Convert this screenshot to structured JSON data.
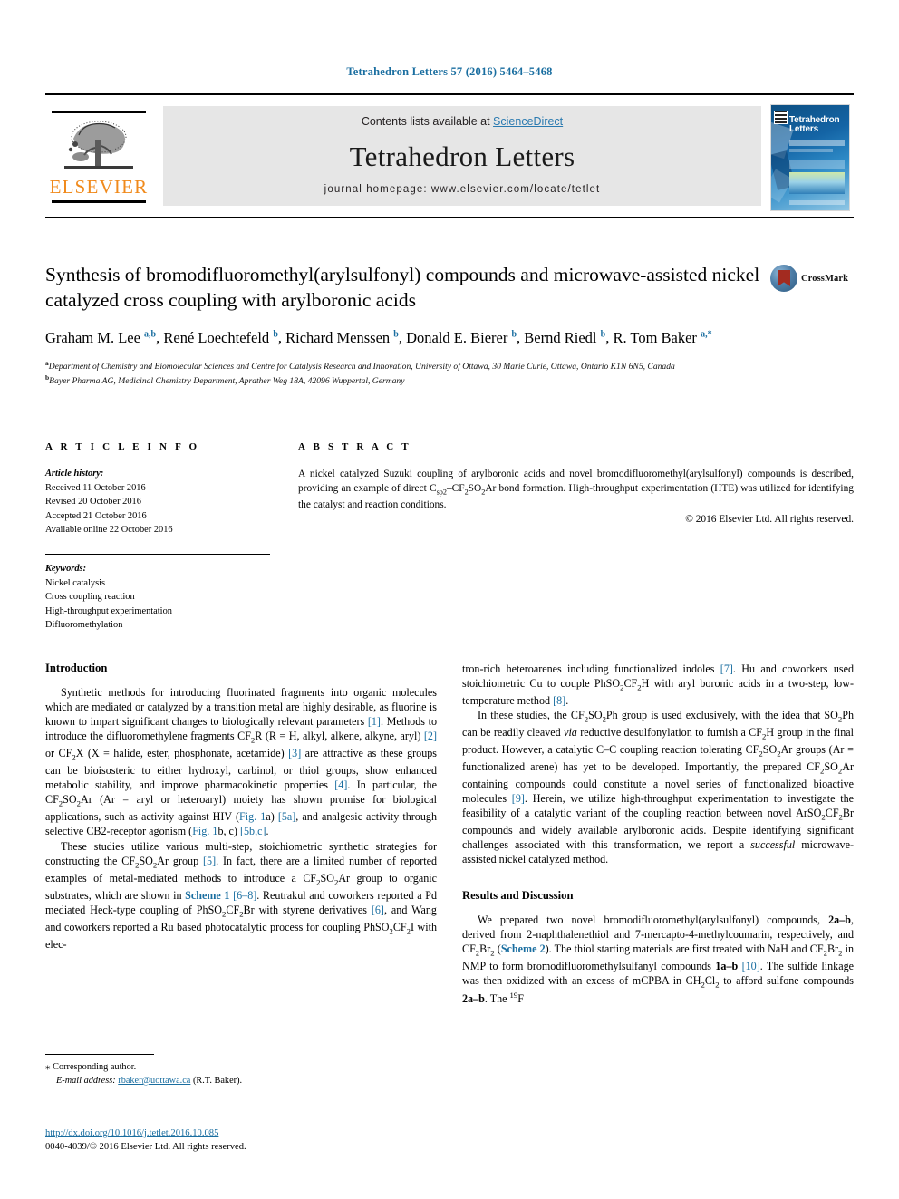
{
  "running_head": "Tetrahedron Letters 57 (2016) 5464–5468",
  "masthead": {
    "publisher_name": "ELSEVIER",
    "contents_prefix": "Contents lists available at ",
    "sciencedirect": "ScienceDirect",
    "journal_name": "Tetrahedron Letters",
    "homepage": "journal homepage: www.elsevier.com/locate/tetlet",
    "cover_title": "Tetrahedron Letters"
  },
  "article": {
    "title": "Synthesis of bromodifluoromethyl(arylsulfonyl) compounds and microwave-assisted nickel catalyzed cross coupling with arylboronic acids",
    "crossmark_label": "CrossMark",
    "authors_html": "Graham M. Lee <sup>a,b</sup>, René Loechtefeld <sup>b</sup>, Richard Menssen <sup>b</sup>, Donald E. Bierer <sup>b</sup>, Bernd Riedl <sup>b</sup>, R. Tom Baker <sup>a,*</sup>",
    "affiliations": [
      "Department of Chemistry and Biomolecular Sciences and Centre for Catalysis Research and Innovation, University of Ottawa, 30 Marie Curie, Ottawa, Ontario K1N 6N5, Canada",
      "Bayer Pharma AG, Medicinal Chemistry Department, Aprather Weg 18A, 42096 Wuppertal, Germany"
    ],
    "affiliation_marks": [
      "a",
      "b"
    ]
  },
  "article_info": {
    "heading": "A R T I C L E    I N F O",
    "history_label": "Article history:",
    "history": [
      "Received 11 October 2016",
      "Revised 20 October 2016",
      "Accepted 21 October 2016",
      "Available online 22 October 2016"
    ],
    "keywords_label": "Keywords:",
    "keywords": [
      "Nickel catalysis",
      "Cross coupling reaction",
      "High-throughput experimentation",
      "Difluoromethylation"
    ]
  },
  "abstract": {
    "heading": "A B S T R A C T",
    "text_html": "A nickel catalyzed Suzuki coupling of arylboronic acids and novel bromodifluoromethyl(arylsulfonyl) compounds is described, providing an example of direct C<sub>sp2</sub>–CF<sub>2</sub>SO<sub>2</sub>Ar bond formation. High-throughput experimentation (HTE) was utilized for identifying the catalyst and reaction conditions.",
    "copyright": "© 2016 Elsevier Ltd. All rights reserved."
  },
  "body": {
    "left_heading": "Introduction",
    "left_paragraphs_html": [
      "Synthetic methods for introducing fluorinated fragments into organic molecules which are mediated or catalyzed by a transition metal are highly desirable, as fluorine is known to impart significant changes to biologically relevant parameters <span class=\"lnk\">[1]</span>. Methods to introduce the difluoromethylene fragments CF<sub>2</sub>R (R = H, alkyl, alkene, alkyne, aryl) <span class=\"lnk\">[2]</span> or CF<sub>2</sub>X (X = halide, ester, phosphonate, acetamide) <span class=\"lnk\">[3]</span> are attractive as these groups can be bioisosteric to either hydroxyl, carbinol, or thiol groups, show enhanced metabolic stability, and improve pharmacokinetic properties <span class=\"lnk\">[4]</span>. In particular, the CF<sub>2</sub>SO<sub>2</sub>Ar (Ar = aryl or heteroaryl) moiety has shown promise for biological applications, such as activity against HIV (<span class=\"lnk\">Fig. 1</span>a) <span class=\"lnk\">[5a]</span>, and analgesic activity through selective CB2-receptor agonism (<span class=\"lnk\">Fig. 1</span>b, c) <span class=\"lnk\">[5b,c]</span>.",
      "These studies utilize various multi-step, stoichiometric synthetic strategies for constructing the CF<sub>2</sub>SO<sub>2</sub>Ar group <span class=\"lnk\">[5]</span>. In fact, there are a limited number of reported examples of metal-mediated methods to introduce a CF<sub>2</sub>SO<sub>2</sub>Ar group to organic substrates, which are shown in <span class=\"lnk-b\">Scheme 1</span> <span class=\"lnk\">[6–8]</span>. Reutrakul and coworkers reported a Pd mediated Heck-type coupling of PhSO<sub>2</sub>CF<sub>2</sub>Br with styrene derivatives <span class=\"lnk\">[6]</span>, and Wang and coworkers reported a Ru based photocatalytic process for coupling PhSO<sub>2</sub>CF<sub>2</sub>I with elec-"
    ],
    "right_paragraphs_html": [
      "tron-rich heteroarenes including functionalized indoles <span class=\"lnk\">[7]</span>. Hu and coworkers used stoichiometric Cu to couple PhSO<sub>2</sub>CF<sub>2</sub>H with aryl boronic acids in a two-step, low-temperature method <span class=\"lnk\">[8]</span>.",
      "In these studies, the CF<sub>2</sub>SO<sub>2</sub>Ph group is used exclusively, with the idea that SO<sub>2</sub>Ph can be readily cleaved <em>via</em> reductive desulfonylation to furnish a CF<sub>2</sub>H group in the final product. However, a catalytic C–C coupling reaction tolerating CF<sub>2</sub>SO<sub>2</sub>Ar groups (Ar = functionalized arene) has yet to be developed. Importantly, the prepared CF<sub>2</sub>SO<sub>2</sub>Ar containing compounds could constitute a novel series of functionalized bioactive molecules <span class=\"lnk\">[9]</span>. Herein, we utilize high-throughput experimentation to investigate the feasibility of a catalytic variant of the coupling reaction between novel ArSO<sub>2</sub>CF<sub>2</sub>Br compounds and widely available arylboronic acids. Despite identifying significant challenges associated with this transformation, we report a <em>successful</em> microwave-assisted nickel catalyzed method."
    ],
    "right_heading": "Results and Discussion",
    "right_paragraphs2_html": [
      "We prepared two novel bromodifluoromethyl(arylsulfonyl) compounds, <strong>2a–b</strong>, derived from 2-naphthalenethiol and 7-mercapto-4-methylcoumarin, respectively, and CF<sub>2</sub>Br<sub>2</sub> (<span class=\"lnk-b\">Scheme 2</span>). The thiol starting materials are first treated with NaH and CF<sub>2</sub>Br<sub>2</sub> in NMP to form bromodifluoromethylsulfanyl compounds <strong>1a–b</strong> <span class=\"lnk\">[10]</span>. The sulfide linkage was then oxidized with an excess of mCPBA in CH<sub>2</sub>Cl<sub>2</sub> to afford sulfone compounds <strong>2a–b</strong>. The <sup>19</sup>F"
    ]
  },
  "footnote": {
    "corresponding_marker": "⁎",
    "corresponding_text": "Corresponding author.",
    "email_label": "E-mail address:",
    "email": "rbaker@uottawa.ca",
    "email_owner": "(R.T. Baker)."
  },
  "doi_block": {
    "doi_url": "http://dx.doi.org/10.1016/j.tetlet.2016.10.085",
    "issn_line": "0040-4039/© 2016 Elsevier Ltd. All rights reserved."
  },
  "colors": {
    "link_blue": "#1a6ea0",
    "sciencedirect_blue": "#2a7ab0",
    "elsevier_orange": "#f08a1c",
    "band_gray": "#e6e6e6"
  }
}
